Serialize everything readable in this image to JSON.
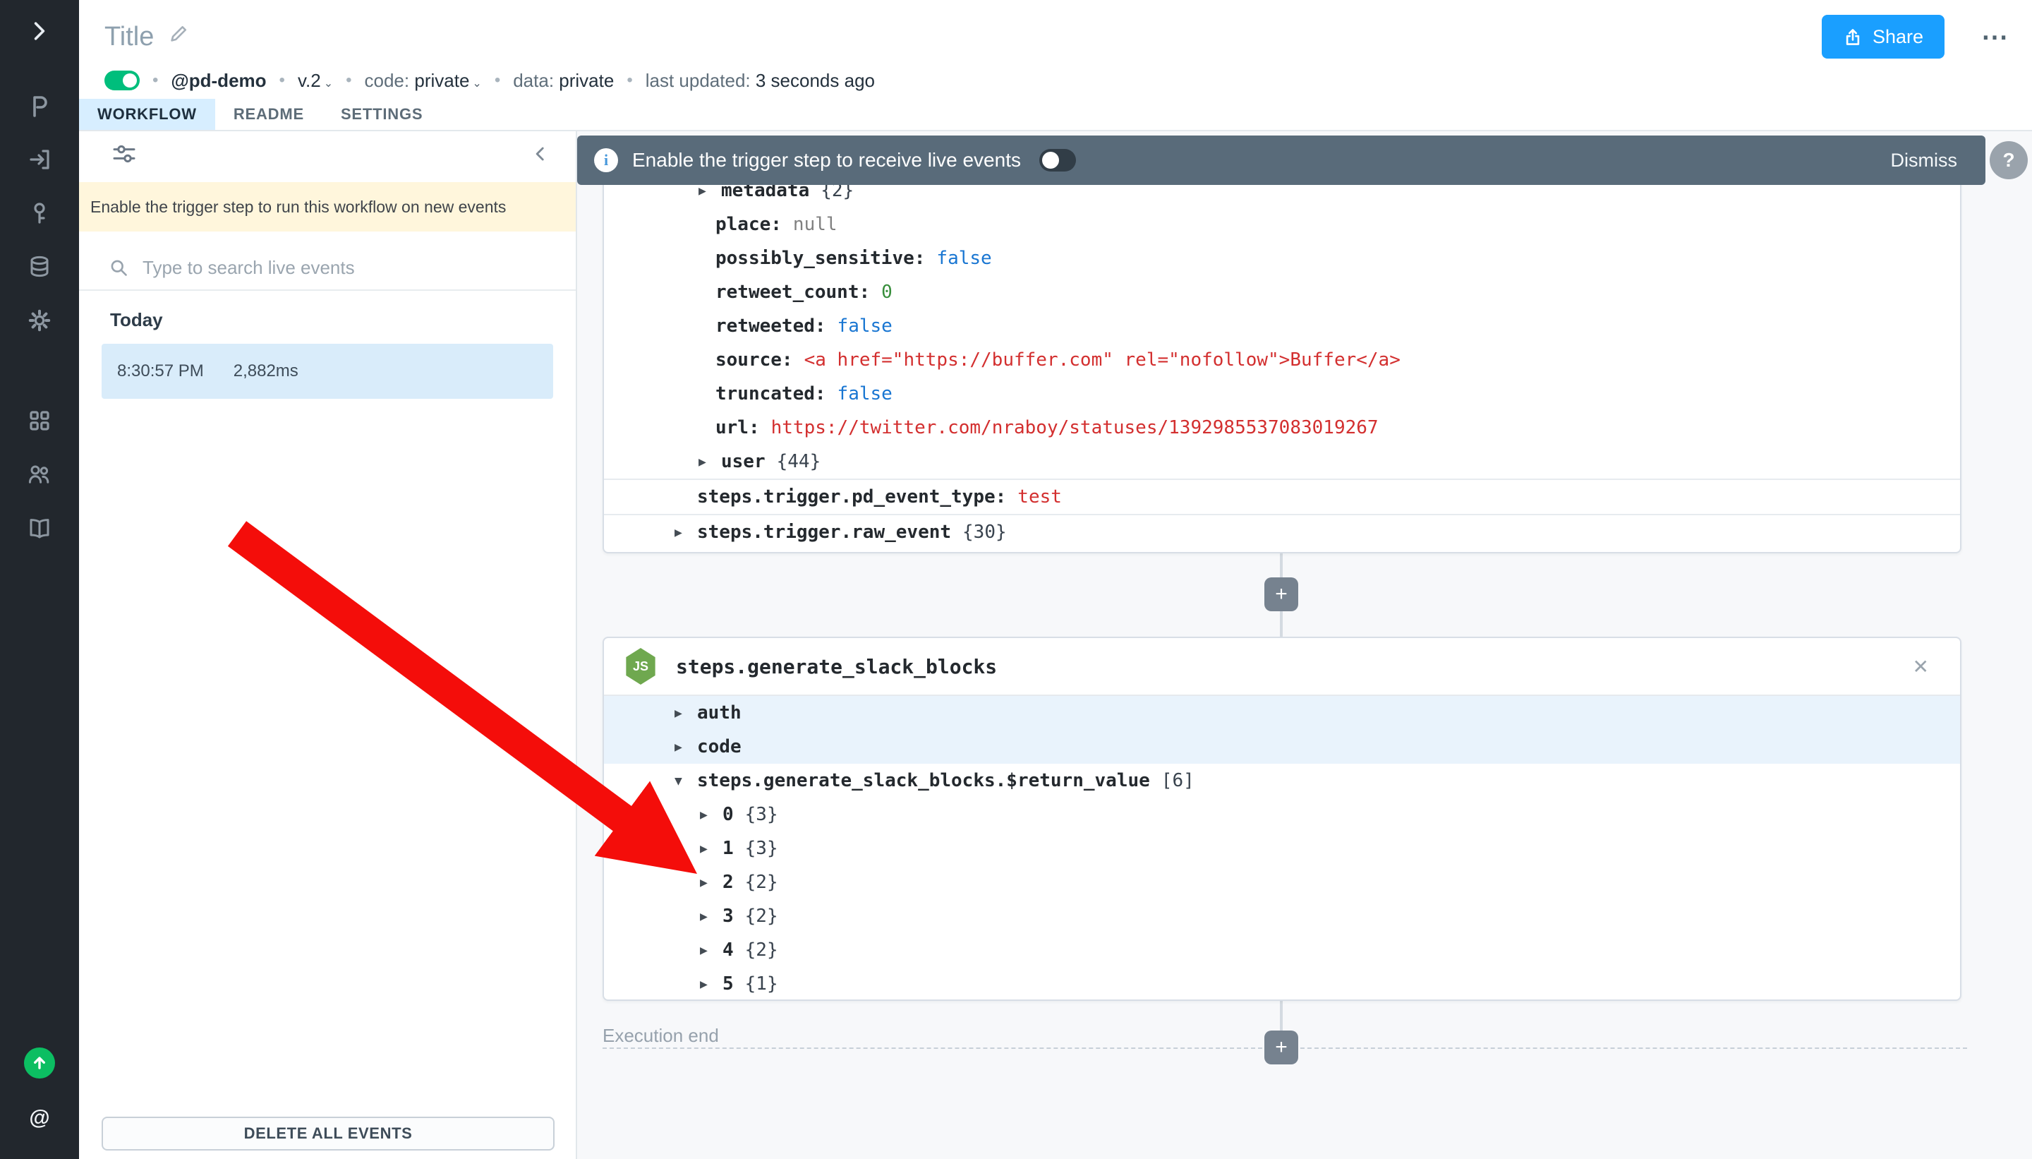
{
  "header": {
    "title": "Title",
    "account": "@pd-demo",
    "version": "v.2",
    "code_label": "code:",
    "code_value": "private",
    "data_label": "data:",
    "data_value": "private",
    "updated_label": "last updated:",
    "updated_value": "3 seconds ago",
    "share": "Share",
    "more": "⋯",
    "dot": "•",
    "chevron": "⌄"
  },
  "tabs": [
    {
      "label": "WORKFLOW"
    },
    {
      "label": "README"
    },
    {
      "label": "SETTINGS"
    }
  ],
  "panel": {
    "notice": "Enable the trigger step to run this workflow on new events",
    "search_placeholder": "Type to search live events",
    "group": "Today",
    "event_time": "8:30:57 PM",
    "event_duration": "2,882ms",
    "delete": "DELETE ALL EVENTS"
  },
  "banner": {
    "text": "Enable the trigger step to receive live events",
    "dismiss": "Dismiss"
  },
  "help": "?",
  "trigger": {
    "clipped": {
      "arrow": "▶",
      "key": "metadata",
      "count": "{2}"
    },
    "rows": [
      {
        "key": "place:",
        "value": "null"
      },
      {
        "key": "possibly_sensitive:",
        "value": "false"
      },
      {
        "key": "retweet_count:",
        "value": "0"
      },
      {
        "key": "retweeted:",
        "value": "false"
      },
      {
        "key": "source:",
        "value": "<a href=\"https://buffer.com\" rel=\"nofollow\">Buffer</a>"
      },
      {
        "key": "truncated:",
        "value": "false"
      },
      {
        "key": "url:",
        "value": "https://twitter.com/nraboy/statuses/1392985537083019267"
      }
    ],
    "user": {
      "arrow": "▶",
      "key": "user",
      "count": "{44}"
    },
    "event_type": {
      "key": "steps.trigger.pd_event_type:",
      "value": "test"
    },
    "raw_event": {
      "arrow": "▶",
      "key": "steps.trigger.raw_event",
      "count": "{30}"
    }
  },
  "step": {
    "title": "steps.generate_slack_blocks",
    "icon_label": "JS",
    "close": "✕",
    "auth": {
      "arrow": "▶",
      "key": "auth"
    },
    "code": {
      "arrow": "▶",
      "key": "code"
    },
    "return": {
      "arrow": "▼",
      "key": "steps.generate_slack_blocks.$return_value",
      "count": "[6]"
    },
    "children": [
      {
        "arrow": "▶",
        "key": "0",
        "count": "{3}"
      },
      {
        "arrow": "▶",
        "key": "1",
        "count": "{3}"
      },
      {
        "arrow": "▶",
        "key": "2",
        "count": "{2}"
      },
      {
        "arrow": "▶",
        "key": "3",
        "count": "{2}"
      },
      {
        "arrow": "▶",
        "key": "4",
        "count": "{2}"
      },
      {
        "arrow": "▶",
        "key": "5",
        "count": "{1}"
      }
    ]
  },
  "plus": "+",
  "execution_end": "Execution end",
  "sidebar": {
    "mentions": "@",
    "icons": [
      "chevron-right",
      "pipedream-logo",
      "exit",
      "key",
      "database",
      "gear",
      "apps-grid",
      "people",
      "book",
      "upgrade",
      "mentions"
    ]
  },
  "colors": {
    "accent_blue": "#1A9FFF",
    "toggle_green": "#00BE7C",
    "banner_slate": "#596B7A",
    "tab_active_bg": "#D7EEFF",
    "selected_event_bg": "#D9ECFA",
    "notice_yellow": "#FFF6DC",
    "json_bool": "#1976D2",
    "json_number": "#388E3C",
    "json_string": "#D32F2F",
    "json_null": "#808080",
    "annotation_red": "#F40D0A"
  }
}
